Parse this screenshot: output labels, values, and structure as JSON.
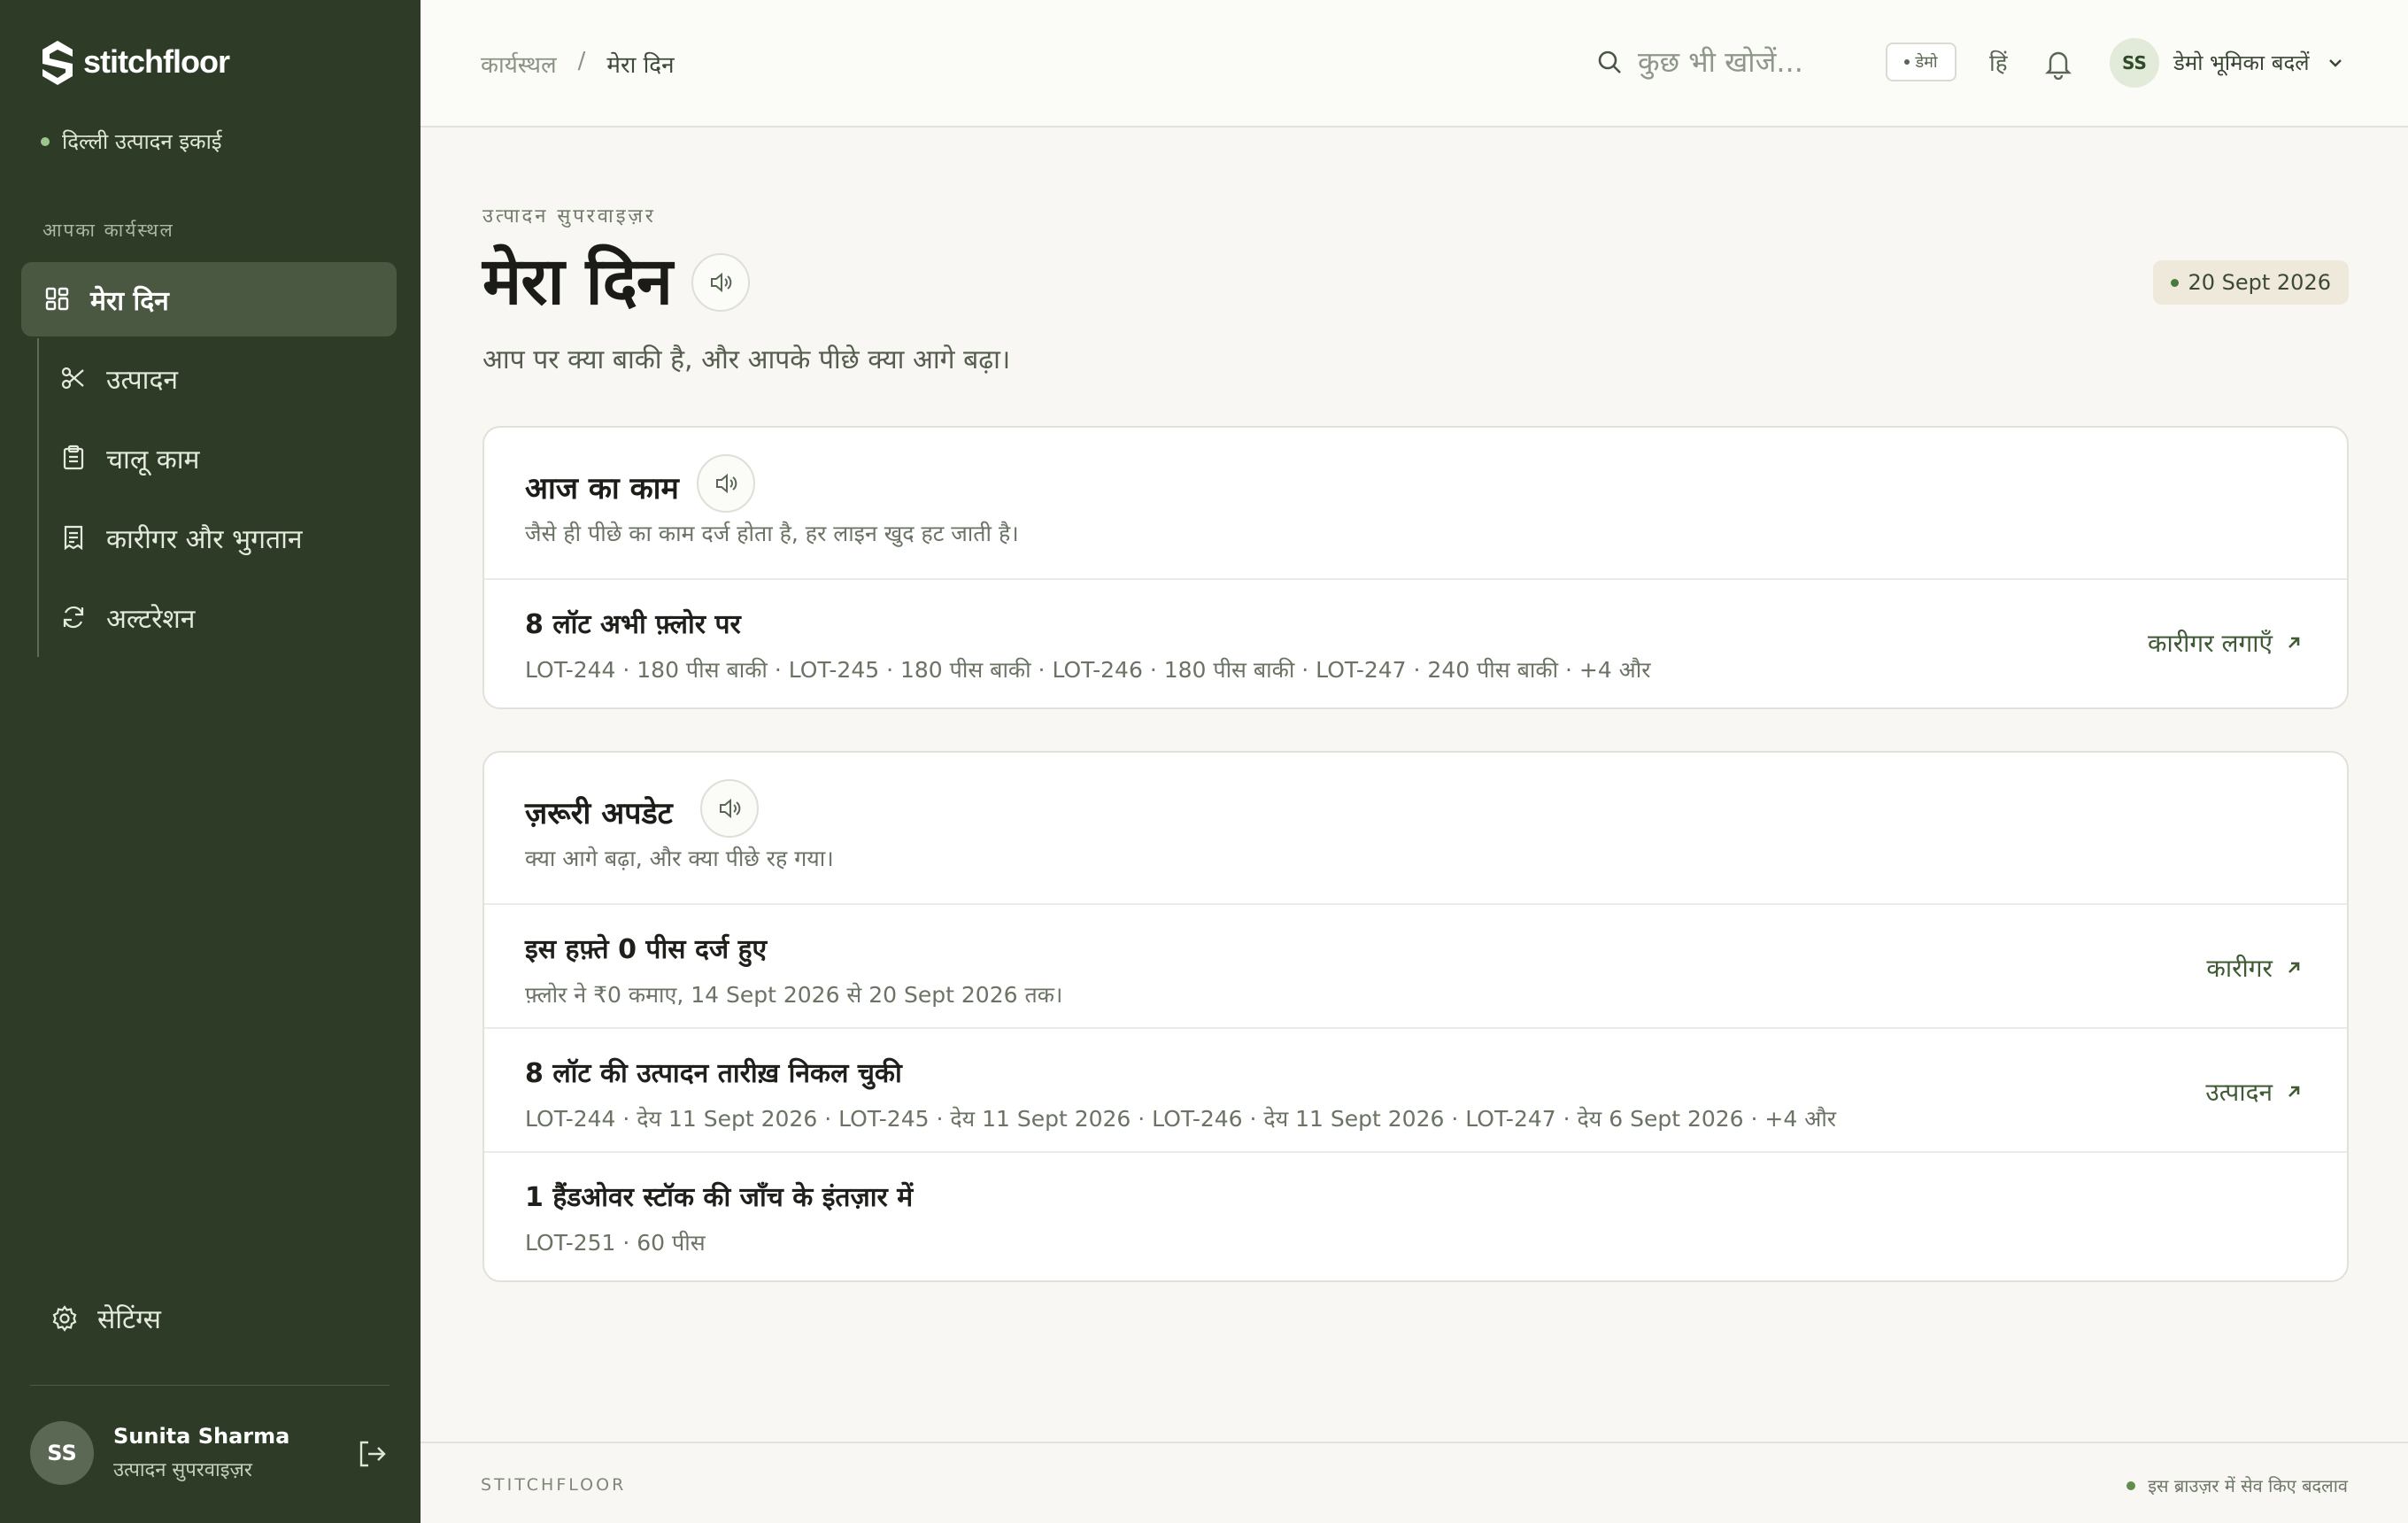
{
  "brand": {
    "name": "stitchfloor"
  },
  "sidebar": {
    "unit": "दिल्ली उत्पादन इकाई",
    "section_label": "आपका कार्यस्थल",
    "items": [
      {
        "label": "मेरा दिन",
        "icon": "dashboard-grid-icon",
        "active": true
      },
      {
        "label": "उत्पादन",
        "icon": "scissors-icon"
      },
      {
        "label": "चालू काम",
        "icon": "clipboard-icon"
      },
      {
        "label": "कारीगर और भुगतान",
        "icon": "receipt-icon"
      },
      {
        "label": "अल्टरेशन",
        "icon": "refresh-icon"
      }
    ],
    "settings": "सेटिंग्स",
    "user": {
      "initials": "SS",
      "name": "Sunita Sharma",
      "role": "उत्पादन सुपरवाइज़र"
    }
  },
  "header": {
    "breadcrumb": [
      "कार्यस्थल",
      "/",
      "मेरा दिन"
    ],
    "search_placeholder": "कुछ भी खोजें...",
    "demo_badge": "डेमो",
    "language": "हिं",
    "avatar_initials": "SS",
    "role_switch": "डेमो भूमिका बदलें"
  },
  "page": {
    "eyebrow": "उत्पादन सुपरवाइज़र",
    "title": "मेरा दिन",
    "date": "20 Sept 2026",
    "lede": "आप पर क्या बाकी है, और आपके पीछे क्या आगे बढ़ा।"
  },
  "today_card": {
    "title": "आज का काम",
    "subtitle": "जैसे ही पीछे का काम दर्ज होता है, हर लाइन खुद हट जाती है।",
    "rows": [
      {
        "title": "8 लॉट अभी फ़्लोर पर",
        "meta": "LOT-244 · 180 पीस बाकी · LOT-245 · 180 पीस बाकी · LOT-246 · 180 पीस बाकी · LOT-247 · 240 पीस बाकी · +4 और",
        "link": "कारीगर लगाएँ"
      }
    ]
  },
  "updates_card": {
    "title": "ज़रूरी अपडेट",
    "subtitle": "क्या आगे बढ़ा, और क्या पीछे रह गया।",
    "rows": [
      {
        "title": "इस हफ़्ते 0 पीस दर्ज हुए",
        "meta": "फ़्लोर ने ₹0 कमाए, 14 Sept 2026 से 20 Sept 2026 तक।",
        "link": "कारीगर"
      },
      {
        "title": "8 लॉट की उत्पादन तारीख़ निकल चुकी",
        "meta": "LOT-244 · देय 11 Sept 2026 · LOT-245 · देय 11 Sept 2026 · LOT-246 · देय 11 Sept 2026 · LOT-247 · देय 6 Sept 2026 · +4 और",
        "link": "उत्पादन"
      },
      {
        "title": "1 हैंडओवर स्टॉक की जाँच के इंतज़ार में",
        "meta": "LOT-251 · 60 पीस",
        "link": ""
      }
    ]
  },
  "footer": {
    "brand": "STITCHFLOOR",
    "note": "इस ब्राउज़र में सेव किए बदलाव"
  },
  "colors": {
    "sidebar_bg": "#2e3c27",
    "active_nav_bg": "#4a5842",
    "accent_green": "#3f5a34",
    "page_bg": "#f8f7f3"
  }
}
